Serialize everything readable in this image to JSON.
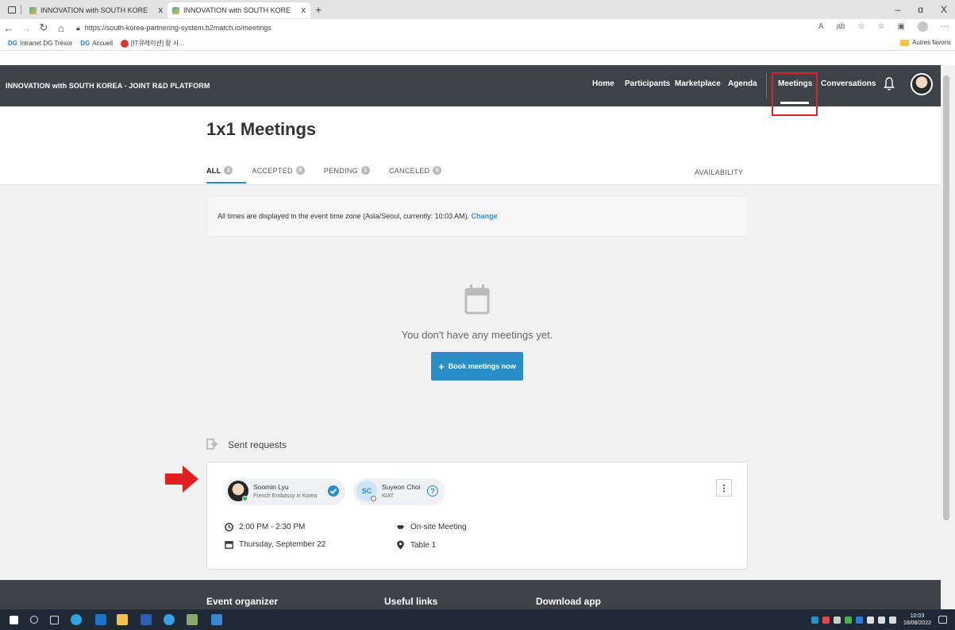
{
  "browser": {
    "tabs": [
      {
        "title": "INNOVATION with SOUTH KORE",
        "close": "x"
      },
      {
        "title": "INNOVATION with SOUTH KORE",
        "close": "x"
      }
    ],
    "new_tab": "+",
    "window_controls": {
      "minimize": "–",
      "restore": "ɑ",
      "close": "X"
    },
    "url": "https://south-korea-partnering-system.b2match.io/meetings",
    "bookmarks": [
      {
        "icon": "DG",
        "label": "Intranet DG Trésor"
      },
      {
        "icon": "DG",
        "label": "Accueil"
      },
      {
        "label": "[IT큐레이션] 랑 사..."
      }
    ],
    "other_favorites": "Autres favoris",
    "more": "···"
  },
  "site": {
    "brand": "INNOVATION with SOUTH KOREA - JOINT R&D PLATFORM",
    "nav": [
      "Home",
      "Participants",
      "Marketplace",
      "Agenda"
    ],
    "active_nav": "Meetings",
    "conversations": "Conversations"
  },
  "page": {
    "title": "1x1 Meetings",
    "tabs": [
      {
        "label": "ALL",
        "count": "1"
      },
      {
        "label": "ACCEPTED",
        "count": "0"
      },
      {
        "label": "PENDING",
        "count": "1"
      },
      {
        "label": "CANCELED",
        "count": "0"
      }
    ],
    "availability": "AVAILABILITY",
    "timezone_text": "All times are displayed in the event time zone (Asia/Seoul, currently: 10:03 AM).",
    "timezone_link": "Change",
    "empty_text": "You don't have any meetings yet.",
    "book_button": "Book meetings now",
    "sent_requests_title": "Sent requests"
  },
  "request": {
    "participants": [
      {
        "name": "Soomin Lyu",
        "org": "French Embassy in Korea"
      },
      {
        "initials": "SC",
        "name": "Suyeon Choi",
        "org": "KIAT"
      }
    ],
    "question": "?",
    "more": "⋮",
    "time": "2:00 PM - 2:30 PM",
    "date": "Thursday, September 22",
    "type": "On-site Meeting",
    "location": "Table 1"
  },
  "footer": {
    "columns": [
      "Event organizer",
      "Useful links",
      "Download app"
    ]
  },
  "taskbar": {
    "time": "10:03",
    "date": "16/08/2022"
  },
  "colors": {
    "header_bg": "#3d4148",
    "accent": "#2b8fc7",
    "highlight_red": "#d8232a"
  }
}
